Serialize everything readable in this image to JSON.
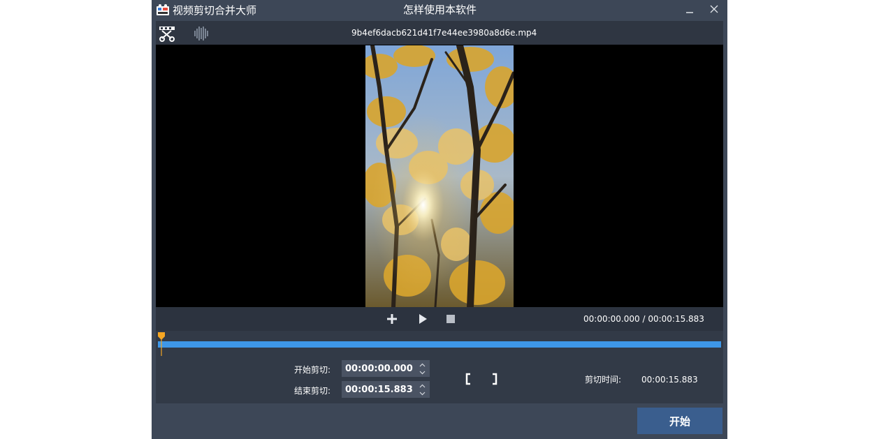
{
  "window": {
    "app_name": "视频剪切合并大师",
    "help_title": "怎样使用本软件"
  },
  "toolbar": {
    "file_name": "9b4ef6dacb621d41f7e44ee3980a8d6e.mp4"
  },
  "player": {
    "current_time": "00:00:00.000",
    "total_time": "00:00:15.883",
    "time_separator": "/"
  },
  "timeline": {
    "position": 0.0
  },
  "cut": {
    "start_label": "开始剪切:",
    "start_value": "00:00:00.000",
    "end_label": "结束剪切:",
    "end_value": "00:00:15.883",
    "duration_label": "剪切时间:",
    "duration_value": "00:00:15.883"
  },
  "footer": {
    "start_button": "开始"
  },
  "colors": {
    "window_bg": "#3d4757",
    "panel_bg": "#323a47",
    "accent_blue": "#3e97e8",
    "playhead": "#f5a623",
    "start_button": "#3a5e8e"
  },
  "icons": {
    "logo": "app-logo-icon",
    "cut_tool": "scissors-cut-icon",
    "wave_tool": "waveform-icon",
    "add": "plus-icon",
    "play": "play-icon",
    "stop": "stop-icon",
    "mark_start": "bracket-start-icon",
    "mark_end": "bracket-end-icon"
  }
}
